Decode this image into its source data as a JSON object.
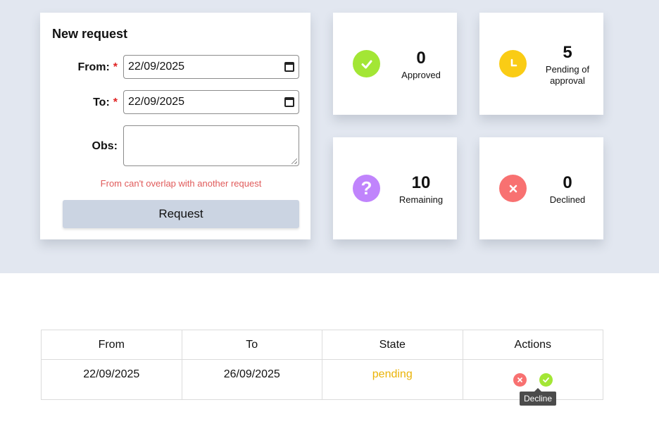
{
  "form": {
    "title": "New request",
    "from_label": "From:",
    "to_label": "To:",
    "obs_label": "Obs:",
    "required_mark": "*",
    "from_value": "22/09/2025",
    "to_value": "22/09/2025",
    "obs_value": "",
    "error": "From can't overlap with another request",
    "submit_label": "Request"
  },
  "stats": {
    "approved": {
      "value": "0",
      "label": "Approved",
      "icon": "check-icon",
      "color": "#a3e635"
    },
    "pending": {
      "value": "5",
      "label": "Pending of approval",
      "icon": "clock-icon",
      "color": "#facc15"
    },
    "remaining": {
      "value": "10",
      "label": "Remaining",
      "icon": "question-icon",
      "color": "#c084fc"
    },
    "declined": {
      "value": "0",
      "label": "Declined",
      "icon": "close-icon",
      "color": "#f87171"
    }
  },
  "table": {
    "headers": [
      "From",
      "To",
      "State",
      "Actions"
    ],
    "rows": [
      {
        "from": "22/09/2025",
        "to": "26/09/2025",
        "state": "pending"
      }
    ]
  },
  "tooltip": "Decline",
  "colors": {
    "background_band": "#e2e7f0",
    "pending_state": "#eab308",
    "error": "#e05a5a",
    "button": "#cbd4e2"
  }
}
